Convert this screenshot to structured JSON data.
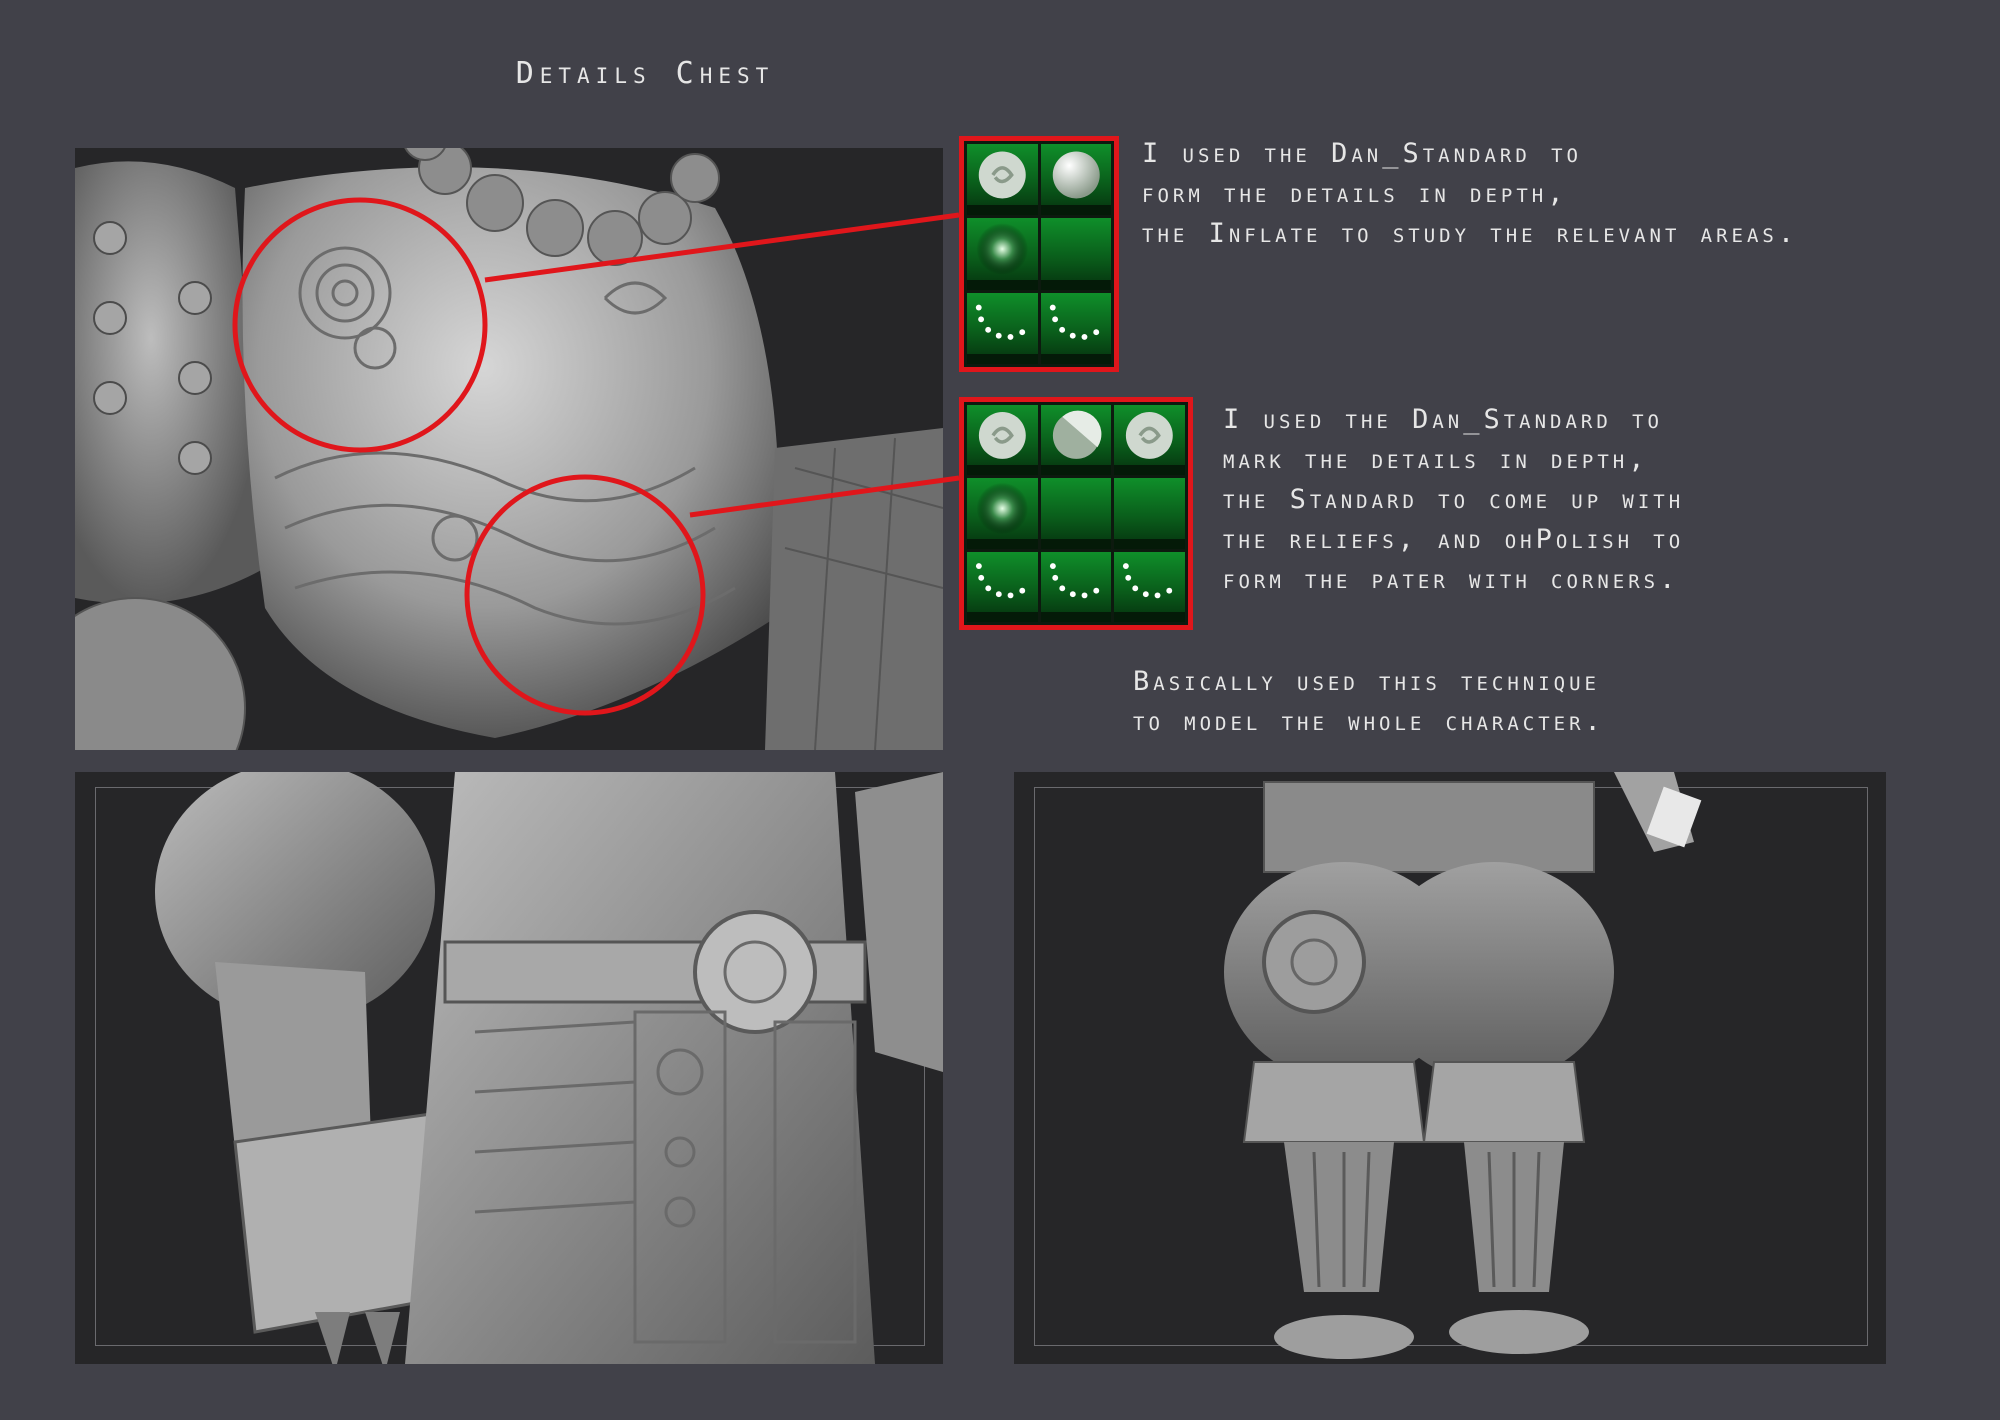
{
  "title": "Details Chest",
  "notes": {
    "top": [
      "I used the Dan_Standard to",
      "form the details in depth,",
      "the Inflate to study the relevant areas."
    ],
    "middle": [
      "I used the Dan_Standard to",
      "mark the details in depth,",
      "the Standard to come up with",
      "the reliefs, and ohPolish to",
      "form the pater with corners."
    ],
    "bottom": [
      "Basically used this technique",
      "to model the whole character."
    ]
  },
  "palettes": {
    "top": {
      "columns": 2,
      "brushes": [
        "swirl-brush-icon",
        "sphere-brush-icon",
        "glow-brush-icon",
        "blank-brush-icon",
        "dots-stroke-icon",
        "dots-stroke-icon"
      ]
    },
    "middle": {
      "columns": 3,
      "brushes": [
        "swirl-brush-icon",
        "half-sphere-brush-icon",
        "swirl-brush-icon",
        "glow-brush-icon",
        "blank-brush-icon",
        "blank-brush-icon",
        "dots-stroke-icon",
        "dots-stroke-icon",
        "dots-stroke-icon"
      ]
    }
  },
  "colors": {
    "background": "#414149",
    "viewport": "#262628",
    "highlight": "#e0161b",
    "brush_slot": "#0f8f2a"
  }
}
